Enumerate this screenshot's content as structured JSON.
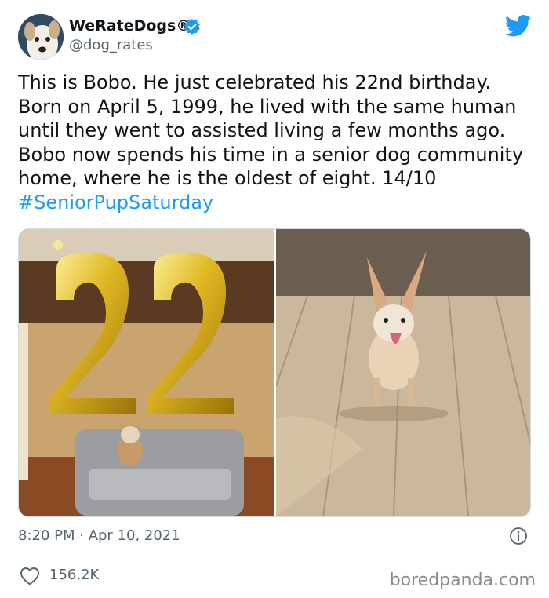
{
  "header": {
    "display_name": "WeRateDogs®",
    "handle": "@dog_rates"
  },
  "icons": {
    "avatar": "dog-avatar",
    "verified": "verified-badge-icon",
    "brand": "twitter-bird-icon",
    "info": "info-icon",
    "like": "heart-icon"
  },
  "tweet": {
    "text": "This is Bobo. He just celebrated his 22nd birthday. Born on April 5, 1999, he lived with the same human until they went to assisted living a few months ago. Bobo now spends his time in a senior dog community home, where he is the oldest of eight. 14/10 ",
    "hashtag": "#SeniorPupSaturday"
  },
  "meta": {
    "timestamp": "8:20 PM · Apr 10, 2021",
    "likes": "156.2K"
  },
  "watermark": "boredpanda.com",
  "colors": {
    "accent": "#1d9bf0",
    "text": "#0f1419",
    "muted": "#536471",
    "border": "#cfd9de"
  }
}
